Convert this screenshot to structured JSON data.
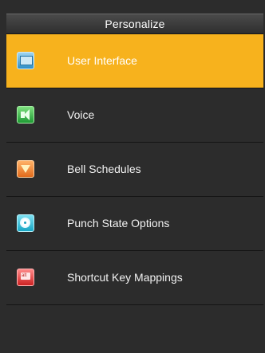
{
  "header": {
    "title": "Personalize"
  },
  "menu": {
    "items": [
      {
        "label": "User Interface",
        "icon": "user-interface-icon",
        "selected": true
      },
      {
        "label": "Voice",
        "icon": "speaker-icon",
        "selected": false
      },
      {
        "label": "Bell Schedules",
        "icon": "bell-icon",
        "selected": false
      },
      {
        "label": "Punch State Options",
        "icon": "gear-icon",
        "selected": false
      },
      {
        "label": "Shortcut Key Mappings",
        "icon": "keyboard-key-icon",
        "selected": false
      }
    ]
  },
  "colors": {
    "selected_background": "#f7b21d",
    "background": "#2c2c2c",
    "title_bar": "#3a3a3a"
  }
}
